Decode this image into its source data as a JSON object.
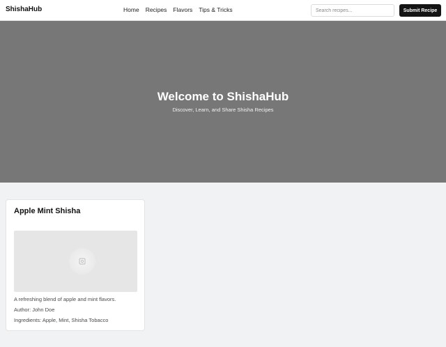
{
  "header": {
    "brand": "ShishaHub",
    "nav": [
      {
        "label": "Home"
      },
      {
        "label": "Recipes"
      },
      {
        "label": "Flavors"
      },
      {
        "label": "Tips & Tricks"
      }
    ],
    "search_placeholder": "Search recipes...",
    "submit_label": "Submit Recipe"
  },
  "hero": {
    "title": "Welcome to ShishaHub",
    "subtitle": "Discover, Learn, and Share Shisha Recipes"
  },
  "recipes": [
    {
      "title": "Apple Mint Shisha",
      "image_icon": "image-placeholder-icon",
      "description": "A refreshing blend of apple and mint flavors.",
      "author": "Author: John Doe",
      "ingredients": "Ingredients: Apple, Mint, Shisha Tobacco"
    }
  ],
  "colors": {
    "header_bg": "#ffffff",
    "hero_bg": "#777777",
    "page_bg": "#f1f2f4",
    "button_bg": "#141414"
  }
}
